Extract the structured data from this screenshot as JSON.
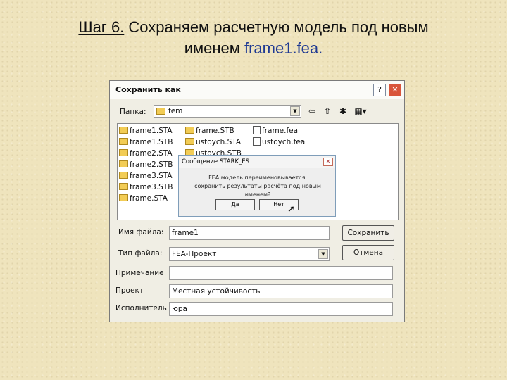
{
  "slide": {
    "title_step": "Шаг 6.",
    "title_rest": " Сохраняем расчетную модель под новым",
    "title_line2": "именем ",
    "title_file": "frame1.fea",
    "title_dot": "."
  },
  "dialog": {
    "title": "Сохранить как",
    "help_label": "?",
    "close_label": "✕",
    "folder_label": "Папка:",
    "folder_value": "fem",
    "files_col1": [
      "frame1.STA",
      "frame1.STB",
      "frame2.STA",
      "frame2.STB",
      "frame3.STA",
      "frame3.STB",
      "frame.STA"
    ],
    "files_col2": [
      "frame.STB",
      "ustoych.STA",
      "ustoych.STB"
    ],
    "files_col3": [
      "frame.fea",
      "ustoych.fea"
    ],
    "filename_label": "Имя файла:",
    "filename_value": "frame1",
    "filetype_label": "Тип файла:",
    "filetype_value": "FEA-Проект",
    "save_button": "Сохранить",
    "cancel_button": "Отмена",
    "note_label": "Примечание",
    "note_value": "",
    "project_label": "Проект",
    "project_value": "Местная устойчивость",
    "author_label": "Исполнитель",
    "author_value": "юра"
  },
  "message": {
    "title": "Сообщение STARK_ES",
    "line1": "FEA модель переименовывается,",
    "line2": "сохранить результаты расчёта под новым именем?",
    "yes_button": "Да",
    "no_button": "Нет"
  },
  "icons": {
    "folder": "folder-icon",
    "up_folder": "up-folder-icon",
    "new_folder": "new-folder-icon",
    "view_menu": "view-menu-icon",
    "cursor": "mouse-cursor-icon"
  }
}
